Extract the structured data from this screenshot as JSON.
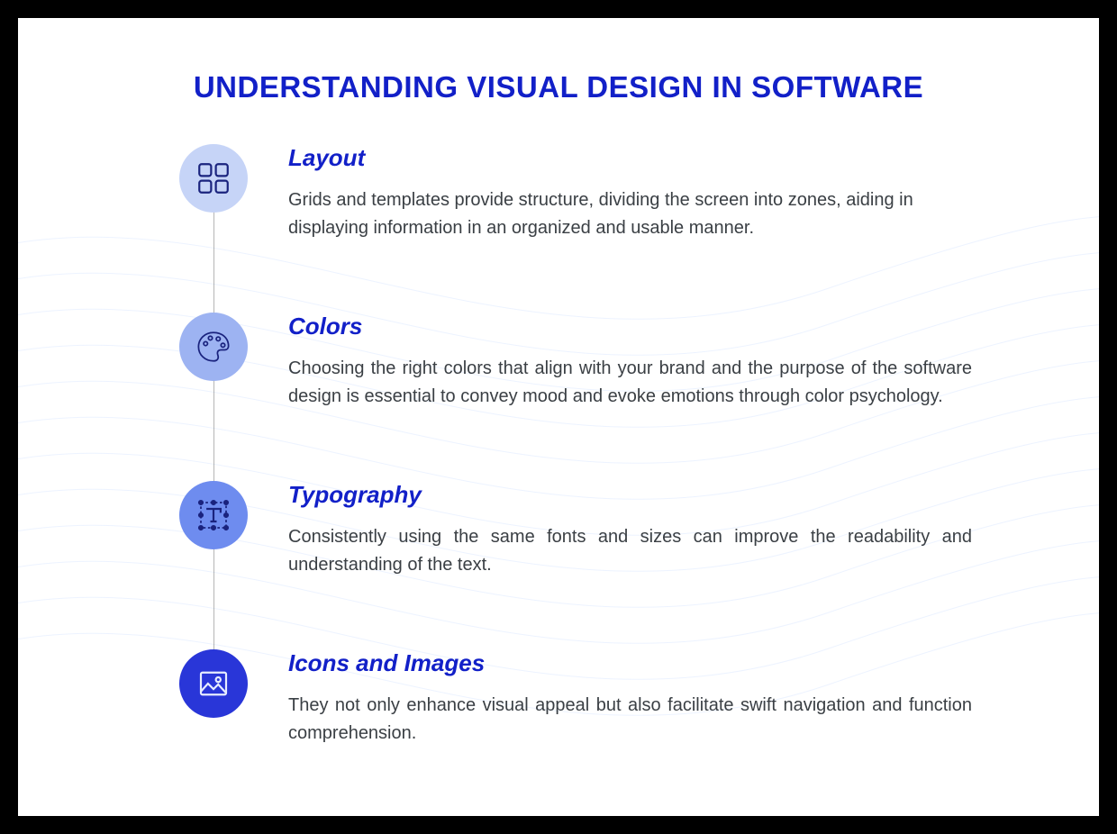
{
  "title": "UNDERSTANDING VISUAL DESIGN IN SOFTWARE",
  "items": [
    {
      "heading": "Layout",
      "desc": "Grids and templates provide structure, dividing the screen into zones, aiding in displaying information in an organized and usable manner."
    },
    {
      "heading": "Colors",
      "desc": "Choosing the right colors that align with your brand and the purpose of the software design is essential to convey mood and evoke emotions through color psychology."
    },
    {
      "heading": "Typography",
      "desc": "Consistently using the same fonts and sizes can improve the readability and understanding of the text."
    },
    {
      "heading": "Icons and Images",
      "desc": "They not only enhance visual appeal but also facilitate swift navigation and function comprehension."
    }
  ]
}
